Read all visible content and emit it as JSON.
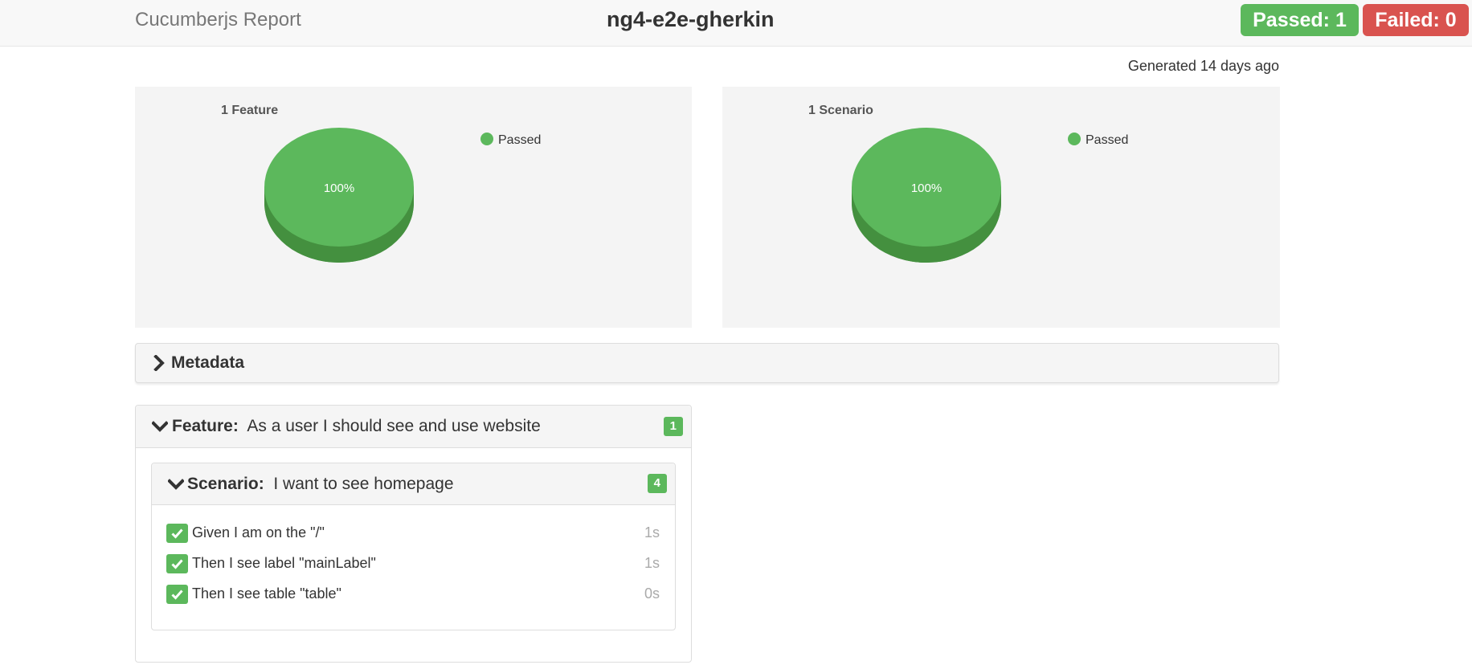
{
  "navbar": {
    "brand": "Cucumberjs Report",
    "title": "ng4-e2e-gherkin",
    "passed_label": "Passed: 1",
    "failed_label": "Failed: 0"
  },
  "generated": "Generated 14 days ago",
  "colors": {
    "passed": "#5cb85c",
    "passed_dark": "#44903f",
    "failed": "#d9534f",
    "panel_bg": "#f4f4f4"
  },
  "chart_data": [
    {
      "type": "pie",
      "title": "1 Feature",
      "legend_position": "top-right",
      "series": [
        {
          "name": "Passed",
          "values": [
            100
          ]
        }
      ],
      "categories": [
        "Passed"
      ],
      "data_labels": [
        "100%"
      ]
    },
    {
      "type": "pie",
      "title": "1 Scenario",
      "legend_position": "top-right",
      "series": [
        {
          "name": "Passed",
          "values": [
            100
          ]
        }
      ],
      "categories": [
        "Passed"
      ],
      "data_labels": [
        "100%"
      ]
    }
  ],
  "metadata": {
    "label": "Metadata",
    "icon": "chevron-right-icon"
  },
  "feature": {
    "keyword": "Feature:",
    "name": "As a user I should see and use website",
    "count": "1",
    "icon": "chevron-down-icon",
    "scenario": {
      "keyword": "Scenario:",
      "name": "I want to see homepage",
      "count": "4",
      "icon": "chevron-down-icon",
      "steps": [
        {
          "text": "Given I am on the \"/\"",
          "duration": "1s",
          "status": "passed",
          "icon": "check-icon"
        },
        {
          "text": "Then I see label \"mainLabel\"",
          "duration": "1s",
          "status": "passed",
          "icon": "check-icon"
        },
        {
          "text": "Then I see table \"table\"",
          "duration": "0s",
          "status": "passed",
          "icon": "check-icon"
        }
      ]
    }
  }
}
